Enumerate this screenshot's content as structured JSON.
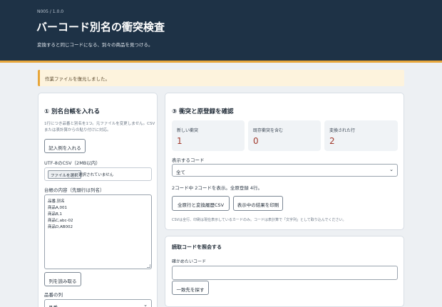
{
  "header": {
    "version": "N005 / 1.0.0",
    "title": "バーコード別名の衝突検査",
    "subtitle": "変換すると同じコードになる、別々の商品を見つける。"
  },
  "notice": "作業ファイルを復元しました。",
  "left_card": {
    "title": "① 別名台帳を入れる",
    "help_lines": [
      "1行につき品番と別名を1つ。元ファイルを変更しません。CSV",
      "または表計算からの貼り付けに対応。"
    ],
    "sample_button": "記入例を入れる",
    "csv_label": "UTF-8のCSV（2MB以内）",
    "file_button": "ファイルを選択",
    "file_status": "選択されていません",
    "ledger_label": "台帳の内容（先頭行は列名）",
    "ledger_lines": [
      "品番,別名",
      "商品A,001",
      "商品B,1",
      "商品C,abc-02",
      "商品D,AB002"
    ],
    "read_columns_button": "列を読み取る",
    "item_column_label": "品番の列",
    "item_column_value": "品番"
  },
  "right_card": {
    "title": "③ 衝突と原登録を確認",
    "stats": [
      {
        "label": "新しい衝突",
        "value": "1"
      },
      {
        "label": "既存衝突を含む",
        "value": "0"
      },
      {
        "label": "変換された行",
        "value": "2"
      }
    ],
    "display_code_label": "表示するコード",
    "display_code_value": "全て",
    "summary": "2コード中 2コードを表示。全原登録 4行。",
    "export_button": "全原行と変換履歴CSV",
    "print_button": "表示中の結果を印刷",
    "note": "CSVは全行、印刷は現在表示しているカードのみ。コードは表計算で「文字列」として取り込んでください。"
  },
  "lookup_card": {
    "title": "読取コードを照会する",
    "input_label": "確かめたいコード",
    "input_value": "",
    "find_button": "一致先を探す"
  },
  "colors": {
    "header_bg": "#1e3246",
    "accent": "#e7a63a",
    "stat_value": "#a13a2d",
    "notice_bg": "#fdf3dd"
  }
}
